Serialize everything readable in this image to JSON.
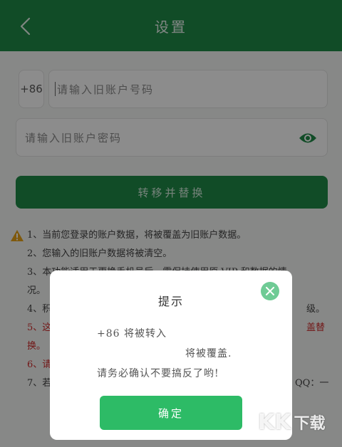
{
  "header": {
    "title": "设置"
  },
  "form": {
    "country_code": "+86",
    "account_placeholder": "请输入旧账户号码",
    "password_placeholder": "请输入旧账户密码",
    "transfer_button": "转移并替换"
  },
  "notes": [
    "1、当前您登录的账户数据，将被覆盖为旧账户数据。",
    "2、您输入的旧账户数据将被清空。",
    "3、本功能适用于更换手机号后，需保持使用原 VIP 和数据的情",
    "况。",
    "4、积",
    "5、这",
    "换。",
    "6、请",
    "7、若"
  ],
  "notes_right": {
    "line5": "级。",
    "line6": "盖替",
    "line9": "QQ：一"
  },
  "dialog": {
    "title": "提示",
    "line1": "+86 将被转入",
    "line2": "将被覆盖.",
    "line3": "请务必确认不要搞反了哟!",
    "confirm": "确定"
  },
  "watermark": {
    "main": "KK",
    "sub": "下载"
  },
  "colors": {
    "brand": "#1f8a47",
    "confirm": "#2dbb66",
    "warning": "#e8a317",
    "alert_text": "#d02a2a"
  }
}
